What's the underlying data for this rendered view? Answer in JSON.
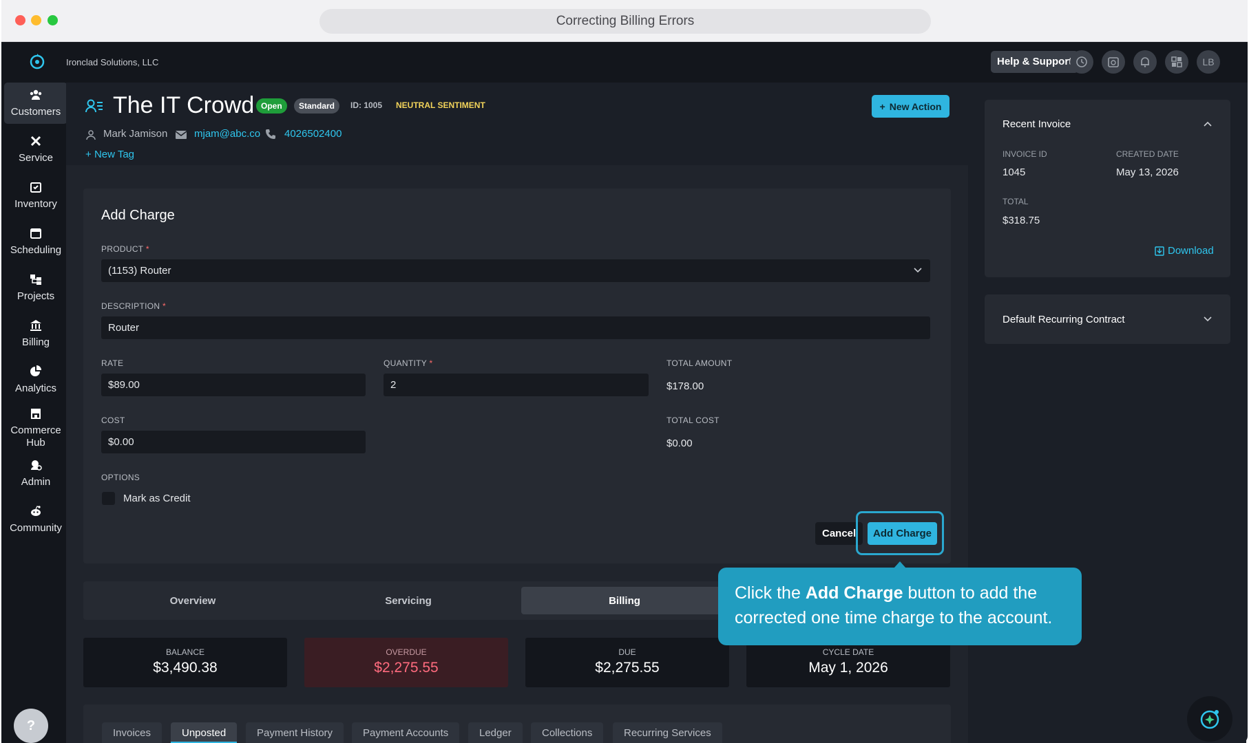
{
  "window": {
    "title": "Correcting Billing Errors"
  },
  "topbar": {
    "company": "Ironclad Solutions, LLC",
    "help_label": "Help & Support",
    "avatar_initials": "LB"
  },
  "sidebar": {
    "items": [
      {
        "label": "Customers",
        "icon": "customers-icon"
      },
      {
        "label": "Service",
        "icon": "service-icon"
      },
      {
        "label": "Inventory",
        "icon": "inventory-icon"
      },
      {
        "label": "Scheduling",
        "icon": "calendar-icon"
      },
      {
        "label": "Projects",
        "icon": "projects-icon"
      },
      {
        "label": "Billing",
        "icon": "bank-icon"
      },
      {
        "label": "Analytics",
        "icon": "pie-chart-icon"
      },
      {
        "label": "Commerce Hub",
        "icon": "store-icon"
      },
      {
        "label": "Admin",
        "icon": "admin-icon"
      },
      {
        "label": "Community",
        "icon": "community-icon"
      }
    ],
    "active": "Customers",
    "help": "?"
  },
  "customer": {
    "name": "The IT Crowd",
    "status": "Open",
    "tier": "Standard",
    "id_label": "ID: 1005",
    "sentiment": "NEUTRAL SENTIMENT",
    "contact_name": "Mark Jamison",
    "email": "mjam@abc.co",
    "phone": "4026502400",
    "new_tag": "New Tag",
    "new_action": "New Action"
  },
  "form": {
    "title": "Add Charge",
    "product_label": "PRODUCT",
    "product_value": "(1153) Router",
    "description_label": "DESCRIPTION",
    "description_value": "Router",
    "rate_label": "RATE",
    "rate_value": "$89.00",
    "quantity_label": "QUANTITY",
    "quantity_value": "2",
    "total_amount_label": "TOTAL AMOUNT",
    "total_amount_value": "$178.00",
    "cost_label": "COST",
    "cost_value": "$0.00",
    "total_cost_label": "TOTAL COST",
    "total_cost_value": "$0.00",
    "options_label": "OPTIONS",
    "credit_label": "Mark as Credit",
    "cancel": "Cancel",
    "submit": "Add Charge",
    "required_mark": "*"
  },
  "tooltip": {
    "pre": "Click the ",
    "bold": "Add Charge",
    "post": " button to add the corrected one time charge to the account."
  },
  "tabs": [
    {
      "label": "Overview"
    },
    {
      "label": "Servicing"
    },
    {
      "label": "Billing",
      "active": true
    }
  ],
  "stats": [
    {
      "label": "BALANCE",
      "value": "$3,490.38"
    },
    {
      "label": "OVERDUE",
      "value": "$2,275.55"
    },
    {
      "label": "DUE",
      "value": "$2,275.55"
    },
    {
      "label": "CYCLE DATE",
      "value": "May 1, 2026"
    }
  ],
  "subtabs": [
    {
      "label": "Invoices"
    },
    {
      "label": "Unposted",
      "active": true
    },
    {
      "label": "Payment History"
    },
    {
      "label": "Payment Accounts"
    },
    {
      "label": "Ledger"
    },
    {
      "label": "Collections"
    },
    {
      "label": "Recurring Services"
    }
  ],
  "recent_invoice": {
    "title": "Recent Invoice",
    "invoice_id_label": "INVOICE ID",
    "invoice_id": "1045",
    "created_label": "CREATED DATE",
    "created": "May 13, 2026",
    "total_label": "TOTAL",
    "total": "$318.75",
    "download": "Download"
  },
  "recurring_contract": {
    "title": "Default Recurring Contract"
  },
  "colors": {
    "accent": "#2fb5e0",
    "open_badge": "#1f9d3a",
    "overdue": "#ff6b7e",
    "sentiment": "#f2d35a"
  }
}
